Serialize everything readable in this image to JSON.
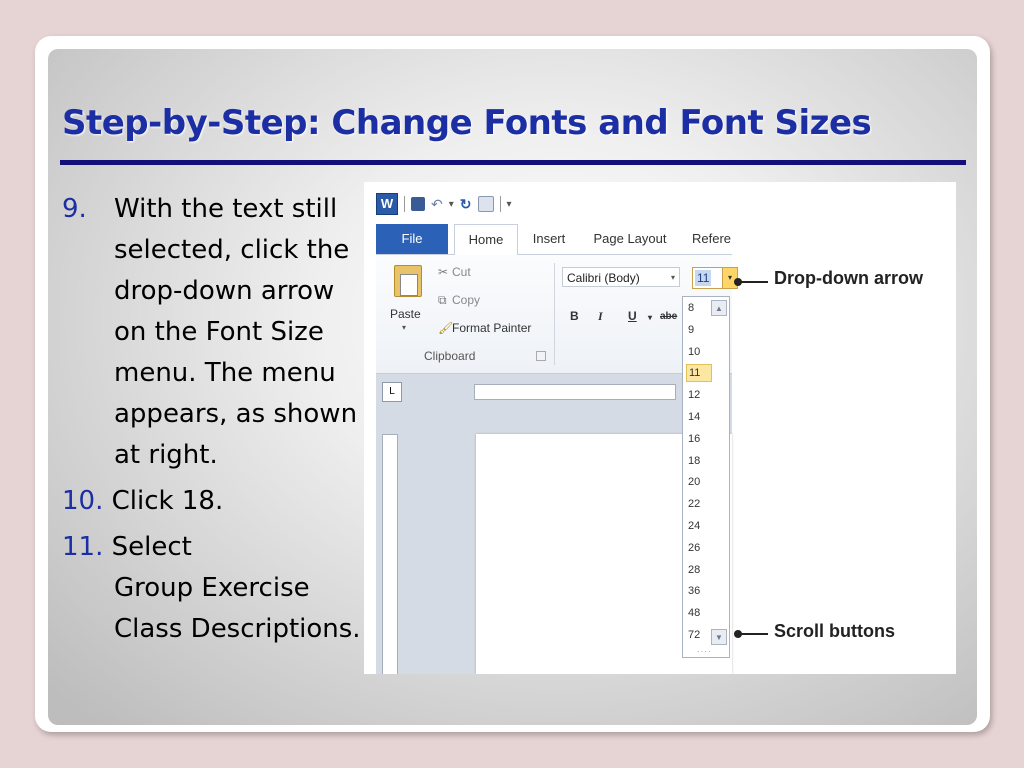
{
  "slide": {
    "title": "Step-by-Step: Change Fonts and Font Sizes",
    "steps": [
      {
        "num": "9.",
        "text": [
          "With the text still selected, click the ",
          "drop-down arrow",
          " on the Font Size menu. The menu appears, as shown at right."
        ]
      },
      {
        "num": "10.",
        "text": [
          "Click ",
          "18",
          "."
        ]
      },
      {
        "num": "11.",
        "text": [
          "Select ",
          "Group Exercise Class Descriptions",
          "."
        ]
      }
    ]
  },
  "screenshot": {
    "word_icon": "W",
    "tabs": {
      "file": "File",
      "home": "Home",
      "insert": "Insert",
      "page_layout": "Page Layout",
      "references": "Refere"
    },
    "clipboard": {
      "paste": "Paste",
      "cut": "Cut",
      "copy": "Copy",
      "format_painter": "Format Painter",
      "group_label": "Clipboard"
    },
    "font": {
      "name": "Calibri (Body)",
      "size": "11",
      "bold": "B",
      "italic": "I",
      "underline": "U",
      "strike": "abe"
    },
    "tab_selector": "L",
    "font_sizes": [
      "8",
      "9",
      "10",
      "11",
      "12",
      "14",
      "16",
      "18",
      "20",
      "22",
      "24",
      "26",
      "28",
      "36",
      "48",
      "72"
    ],
    "highlighted_size": "11",
    "callouts": {
      "dropdown": "Drop-down arrow",
      "scroll": "Scroll buttons"
    }
  }
}
